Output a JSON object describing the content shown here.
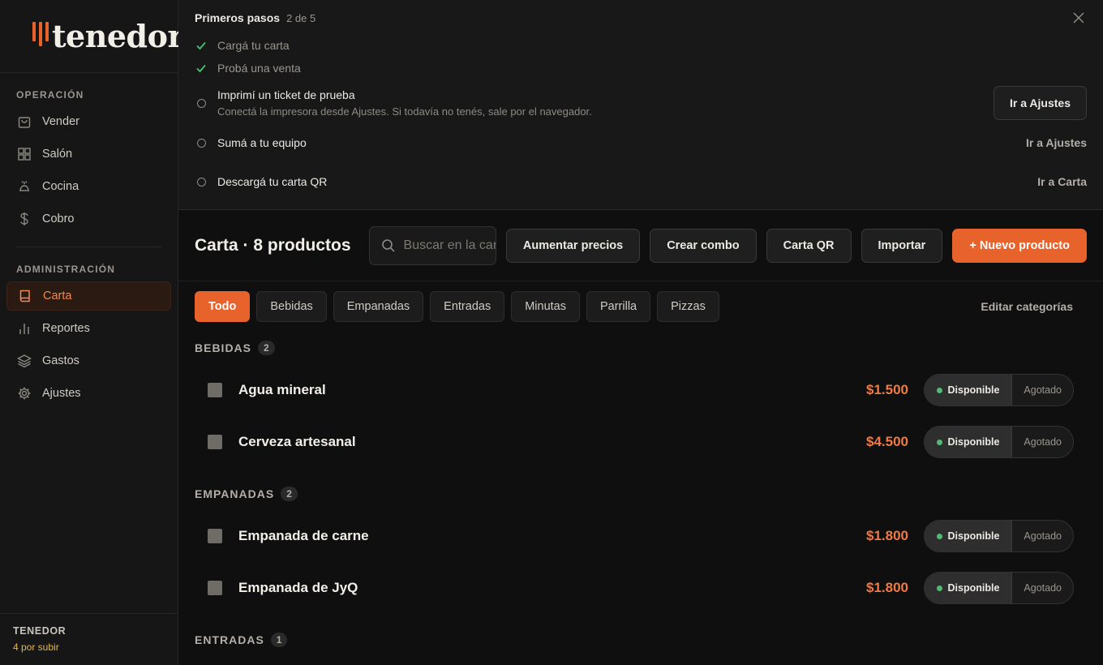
{
  "brand": {
    "logo_text": "tenedor",
    "accent": "#e8622c"
  },
  "sidebar": {
    "sections": [
      {
        "heading": "OPERACIÓN",
        "items": [
          {
            "label": "Vender",
            "icon": "shopping-bag-icon"
          },
          {
            "label": "Salón",
            "icon": "grid-icon"
          },
          {
            "label": "Cocina",
            "icon": "chef-hat-icon"
          },
          {
            "label": "Cobro",
            "icon": "dollar-icon"
          }
        ]
      },
      {
        "heading": "ADMINISTRACIÓN",
        "items": [
          {
            "label": "Carta",
            "icon": "book-icon",
            "active": true
          },
          {
            "label": "Reportes",
            "icon": "bar-chart-icon"
          },
          {
            "label": "Gastos",
            "icon": "layers-icon"
          },
          {
            "label": "Ajustes",
            "icon": "gear-icon"
          }
        ]
      }
    ],
    "footer": {
      "name": "TENEDOR",
      "status": "4 por subir"
    }
  },
  "onboarding": {
    "title": "Primeros pasos",
    "count": "2 de 5",
    "steps": [
      {
        "label": "Cargá tu carta",
        "done": true
      },
      {
        "label": "Probá una venta",
        "done": true
      },
      {
        "label": "Imprimí un ticket de prueba",
        "desc": "Conectá la impresora desde Ajustes. Si todavía no tenés, sale por el navegador.",
        "action": "Ir a Ajustes"
      },
      {
        "label": "Sumá a tu equipo",
        "action": "Ir a Ajustes"
      },
      {
        "label": "Descargá tu carta QR",
        "action": "Ir a Carta"
      }
    ]
  },
  "toolbar": {
    "title": "Carta · 8 productos",
    "search_placeholder": "Buscar en la carta",
    "buttons": [
      "Aumentar precios",
      "Crear combo",
      "Carta QR",
      "Importar",
      "+ Nuevo producto"
    ]
  },
  "categories": {
    "tabs": [
      "Todo",
      "Bebidas",
      "Empanadas",
      "Entradas",
      "Minutas",
      "Parrilla",
      "Pizzas"
    ],
    "active": "Todo",
    "edit_label": "Editar categorías"
  },
  "groups": [
    {
      "name": "BEBIDAS",
      "count": "2",
      "products": [
        {
          "name": "Agua mineral",
          "price": "$1.500"
        },
        {
          "name": "Cerveza artesanal",
          "price": "$4.500"
        }
      ]
    },
    {
      "name": "EMPANADAS",
      "count": "2",
      "products": [
        {
          "name": "Empanada de carne",
          "price": "$1.800"
        },
        {
          "name": "Empanada de JyQ",
          "price": "$1.800"
        }
      ]
    },
    {
      "name": "ENTRADAS",
      "count": "1",
      "products": []
    }
  ],
  "status_options": {
    "available": "Disponible",
    "sold_out": "Agotado"
  }
}
